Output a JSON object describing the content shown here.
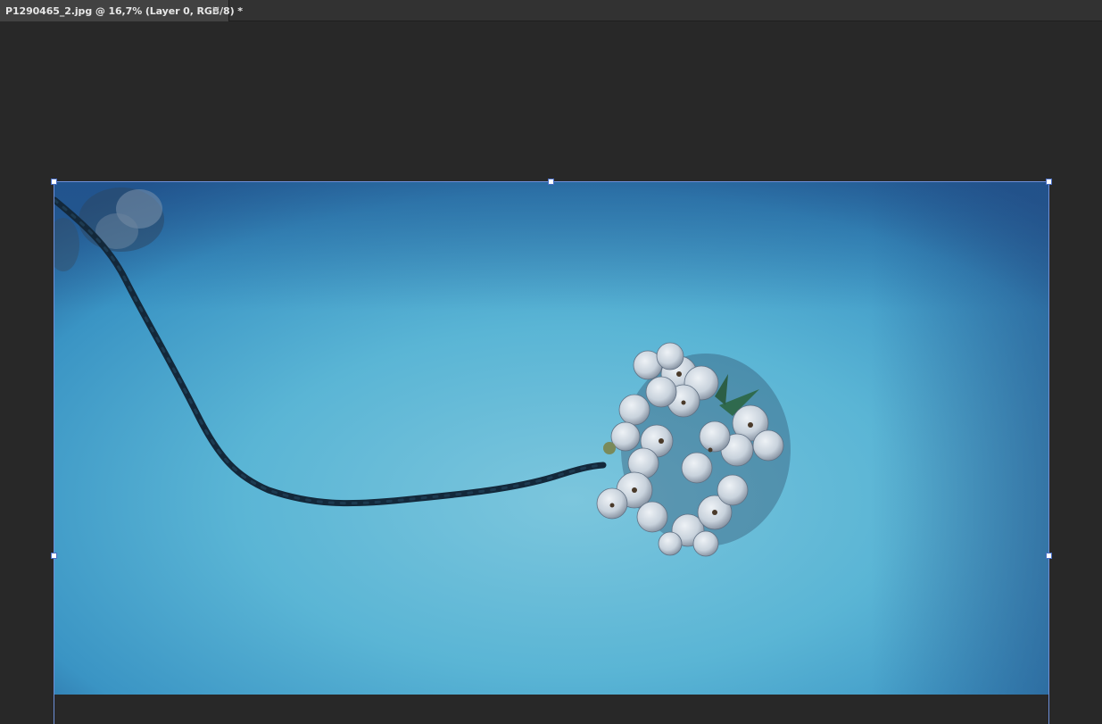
{
  "document_tab": {
    "title": "P1290465_2.jpg @ 16,7% (Layer 0, RGB/8) *",
    "close_glyph": "×"
  },
  "canvas": {
    "background_color": "#282828",
    "selection_color": "#6d8fd8"
  },
  "photo": {
    "sky_light": "#78c0d8",
    "sky_dark": "#23508a",
    "branch_color": "#142a3a"
  },
  "icons": {
    "tab_close": "close-icon"
  }
}
